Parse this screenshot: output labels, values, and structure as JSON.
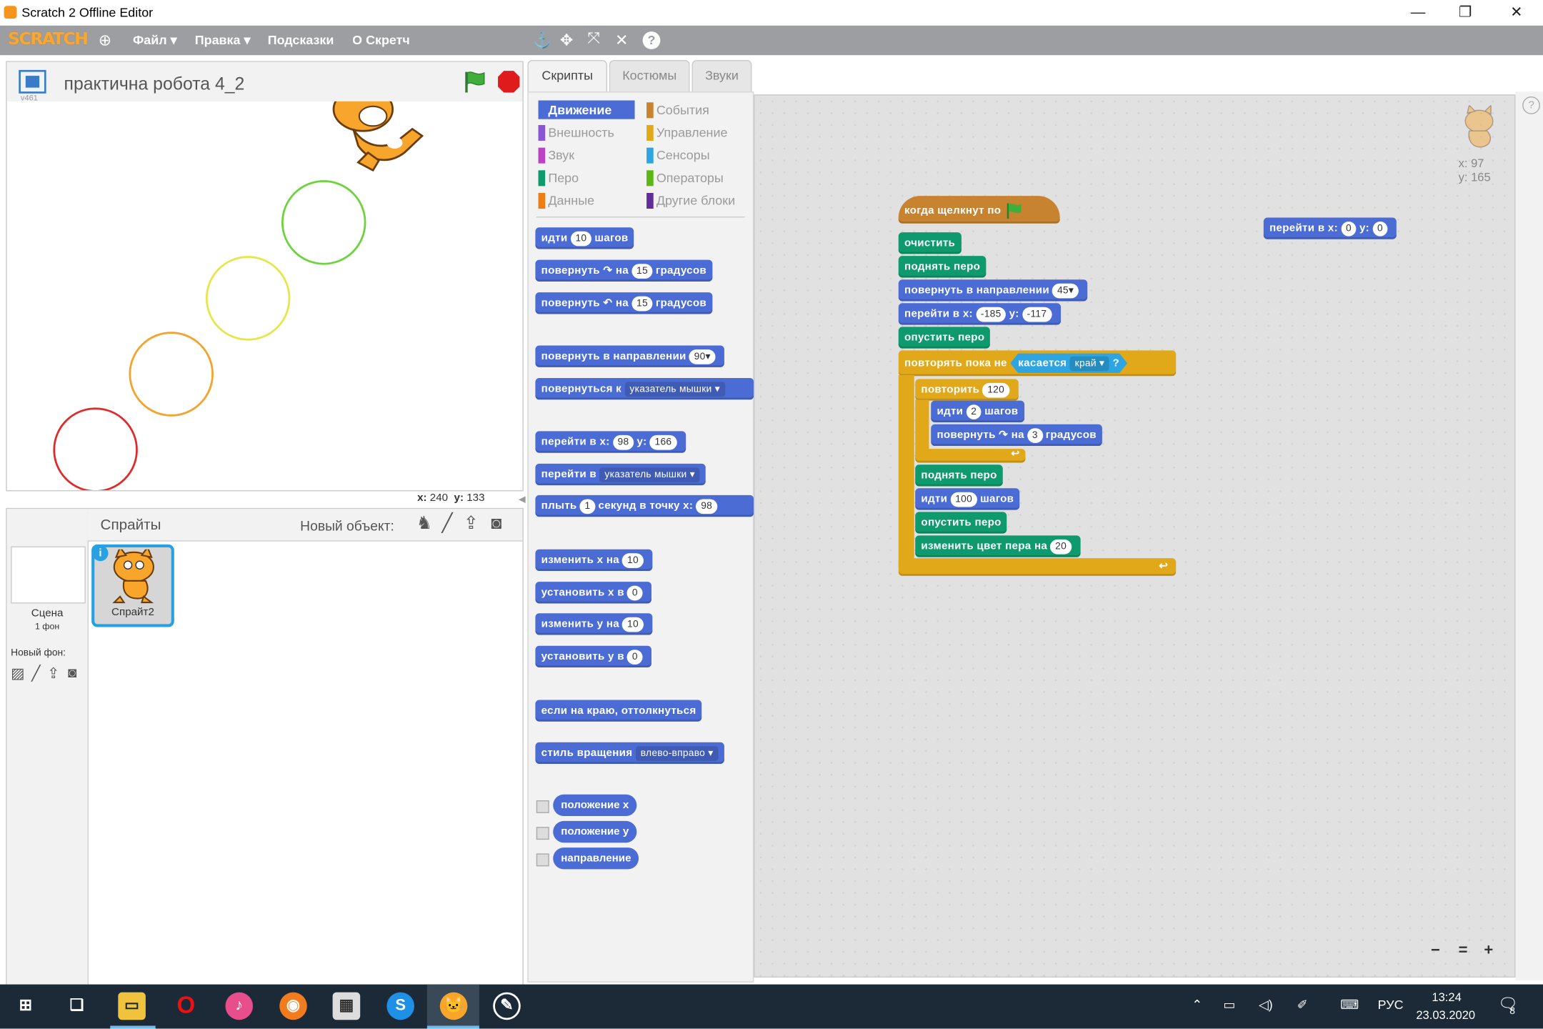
{
  "window": {
    "title": "Scratch 2 Offline Editor",
    "minimize": "—",
    "restore": "❐",
    "close": "✕"
  },
  "menubar": {
    "logo": "SCRATCH",
    "globe_icon": "globe-icon",
    "file": "Файл ▾",
    "edit": "Правка ▾",
    "tips": "Подсказки",
    "about": "О Скретч",
    "tools": [
      "stamp-icon",
      "grow-icon",
      "expand-icon",
      "shrink-icon",
      "help-icon"
    ]
  },
  "stage": {
    "title": "практична робота 4_2",
    "version": "v461",
    "mouse_x_label": "x:",
    "mouse_x": "240",
    "mouse_y_label": "y:",
    "mouse_y": "133",
    "circles": [
      {
        "color": "#e02a2a"
      },
      {
        "color": "#f5a22a"
      },
      {
        "color": "#e6e64a"
      },
      {
        "color": "#6ad43a"
      }
    ]
  },
  "sprites": {
    "header": "Спрайты",
    "new_object": "Новый объект:",
    "scene_label": "Сцена",
    "scene_backdrops": "1 фон",
    "new_backdrop": "Новый фон:",
    "sprite_name": "Спрайт2"
  },
  "tabs": {
    "scripts": "Скрипты",
    "costumes": "Костюмы",
    "sounds": "Звуки"
  },
  "categories": [
    {
      "label": "Движение",
      "color": "#4a6cd4"
    },
    {
      "label": "Внешность",
      "color": "#8a55d7"
    },
    {
      "label": "Звук",
      "color": "#bb42c3"
    },
    {
      "label": "Перо",
      "color": "#0e9a6c"
    },
    {
      "label": "Данные",
      "color": "#ee7d16"
    },
    {
      "label": "События",
      "color": "#c88330"
    },
    {
      "label": "Управление",
      "color": "#e1a91a"
    },
    {
      "label": "Сенсоры",
      "color": "#2ca5e2"
    },
    {
      "label": "Операторы",
      "color": "#5cb712"
    },
    {
      "label": "Другие блоки",
      "color": "#632d99"
    }
  ],
  "palette": {
    "move": {
      "a": "идти",
      "n": "10",
      "b": "шагов"
    },
    "turn_right": {
      "a": "повернуть",
      "icon": "↷",
      "b": "на",
      "n": "15",
      "c": "градусов"
    },
    "turn_left": {
      "a": "повернуть",
      "icon": "↶",
      "b": "на",
      "n": "15",
      "c": "градусов"
    },
    "point_dir": {
      "a": "повернуть в направлении",
      "n": "90▾"
    },
    "point_towards": {
      "a": "повернуться к",
      "d": "указатель мышки ▾"
    },
    "goto_xy": {
      "a": "перейти в x:",
      "x": "98",
      "b": "y:",
      "y": "166"
    },
    "goto": {
      "a": "перейти в",
      "d": "указатель мышки ▾"
    },
    "glide": {
      "a": "плыть",
      "n": "1",
      "b": "секунд в точку x:",
      "x": "98"
    },
    "change_x": {
      "a": "изменить х на",
      "n": "10"
    },
    "set_x": {
      "a": "установить х в",
      "n": "0"
    },
    "change_y": {
      "a": "изменить у на",
      "n": "10"
    },
    "set_y": {
      "a": "установить у в",
      "n": "0"
    },
    "bounce": {
      "a": "если на краю, оттолкнуться"
    },
    "rot_style": {
      "a": "стиль вращения",
      "d": "влево-вправо ▾"
    },
    "reporters": [
      "положение x",
      "положение y",
      "направление"
    ]
  },
  "script": {
    "hat": {
      "a": "когда щелкнут по"
    },
    "clear": "очистить",
    "pen_up1": "поднять перо",
    "point_dir": {
      "a": "повернуть в направлении",
      "n": "45▾"
    },
    "goto": {
      "a": "перейти в x:",
      "x": "-185",
      "b": "y:",
      "y": "-117"
    },
    "pen_down1": "опустить перо",
    "repeat_until": {
      "a": "повторять пока не",
      "sense": "касается",
      "d": "край ▾",
      "q": "?"
    },
    "repeat": {
      "a": "повторить",
      "n": "120"
    },
    "move": {
      "a": "идти",
      "n": "2",
      "b": "шагов"
    },
    "turn": {
      "a": "повернуть",
      "icon": "↷",
      "b": "на",
      "n": "3",
      "c": "градусов"
    },
    "pen_up2": "поднять перо",
    "move2": {
      "a": "идти",
      "n": "100",
      "b": "шагов"
    },
    "pen_down2": "опустить перо",
    "change_color": {
      "a": "изменить цвет пера на",
      "n": "20"
    },
    "loose_goto": {
      "a": "перейти в x:",
      "x": "0",
      "b": "y:",
      "y": "0"
    }
  },
  "sprite_info": {
    "x_label": "x:",
    "x": "97",
    "y_label": "y:",
    "y": "165"
  },
  "zoom": {
    "out": "−",
    "reset": "=",
    "in": "+"
  },
  "taskbar": {
    "lang": "РУС",
    "time": "13:24",
    "date": "23.03.2020",
    "notifications": "8",
    "apps": [
      "start-icon",
      "task-view-icon",
      "explorer-icon",
      "opera-icon",
      "itunes-icon",
      "firefox-icon",
      "calculator-icon",
      "skype-icon",
      "scratch-icon",
      "chat-icon"
    ]
  }
}
